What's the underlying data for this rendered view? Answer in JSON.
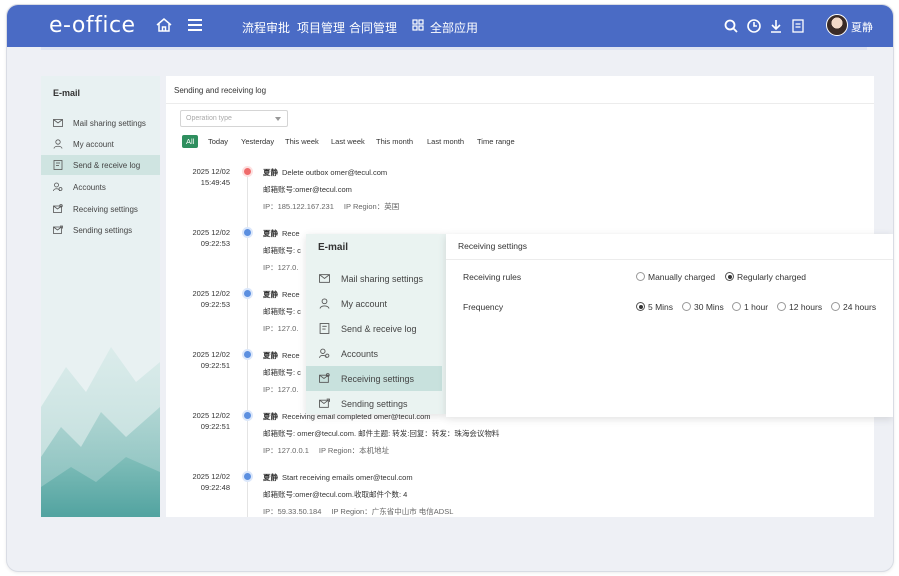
{
  "app": {
    "logo": "e-office",
    "nav": [
      "流程审批",
      "项目管理",
      "合同管理"
    ],
    "all_apps": "全部应用",
    "username": "夏静",
    "brand_color": "#4a6bc5"
  },
  "sidebar": {
    "title": "E-mail",
    "items": [
      {
        "label": "Mail sharing settings",
        "icon": "mail-share-icon"
      },
      {
        "label": "My account",
        "icon": "user-icon"
      },
      {
        "label": "Send & receive log",
        "icon": "log-icon"
      },
      {
        "label": "Accounts",
        "icon": "accounts-icon"
      },
      {
        "label": "Receiving settings",
        "icon": "receive-icon"
      },
      {
        "label": "Sending settings",
        "icon": "send-icon"
      }
    ]
  },
  "main": {
    "title": "Sending and receiving log",
    "operation_type_placeholder": "Operation type",
    "filters": [
      "All",
      "Today",
      "Yesterday",
      "This week",
      "Last week",
      "This month",
      "Last month",
      "Time range"
    ],
    "entries": [
      {
        "date": "2025 12/02",
        "time": "15:49:45",
        "user": "夏静",
        "action": "Delete outbox omer@tecul.com",
        "detail": "邮箱账号:omer@tecul.com",
        "ip": "IP：185.122.167.231",
        "region": "IP Region：英国"
      },
      {
        "date": "2025 12/02",
        "time": "09:22:53",
        "user": "夏静",
        "action": "Rece",
        "detail": "邮箱账号: c",
        "ip": "IP：127.0.",
        "region": ""
      },
      {
        "date": "2025 12/02",
        "time": "09:22:53",
        "user": "夏静",
        "action": "Rece",
        "detail": "邮箱账号: c",
        "ip": "IP：127.0.",
        "region": ""
      },
      {
        "date": "2025 12/02",
        "time": "09:22:51",
        "user": "夏静",
        "action": "Rece",
        "detail": "邮箱账号: c",
        "ip": "IP：127.0.",
        "region": ""
      },
      {
        "date": "2025 12/02",
        "time": "09:22:51",
        "user": "夏静",
        "action": "Receiving email completed omer@tecul.com",
        "detail": "邮箱账号: omer@tecul.com. 邮件主题: 转发:回复：转发：珠海会议物料",
        "ip": "IP：127.0.0.1",
        "region": "IP Region：本机地址"
      },
      {
        "date": "2025 12/02",
        "time": "09:22:48",
        "user": "夏静",
        "action": "Start receiving emails omer@tecul.com",
        "detail": "邮箱账号:omer@tecul.com.收取邮件个数: 4",
        "ip": "IP：59.33.50.184",
        "region": "IP Region：广东省中山市 电信ADSL"
      }
    ]
  },
  "popup_menu": {
    "title": "E-mail",
    "items": [
      "Mail sharing settings",
      "My account",
      "Send & receive log",
      "Accounts",
      "Receiving settings",
      "Sending settings"
    ]
  },
  "receiving_settings": {
    "title": "Receiving settings",
    "rules_label": "Receiving rules",
    "rules_options": [
      "Manually charged",
      "Regularly charged"
    ],
    "rules_selected": "Regularly charged",
    "frequency_label": "Frequency",
    "frequency_options": [
      "5 Mins",
      "30 Mins",
      "1 hour",
      "12 hours",
      "24 hours"
    ],
    "frequency_selected": "5 Mins"
  }
}
